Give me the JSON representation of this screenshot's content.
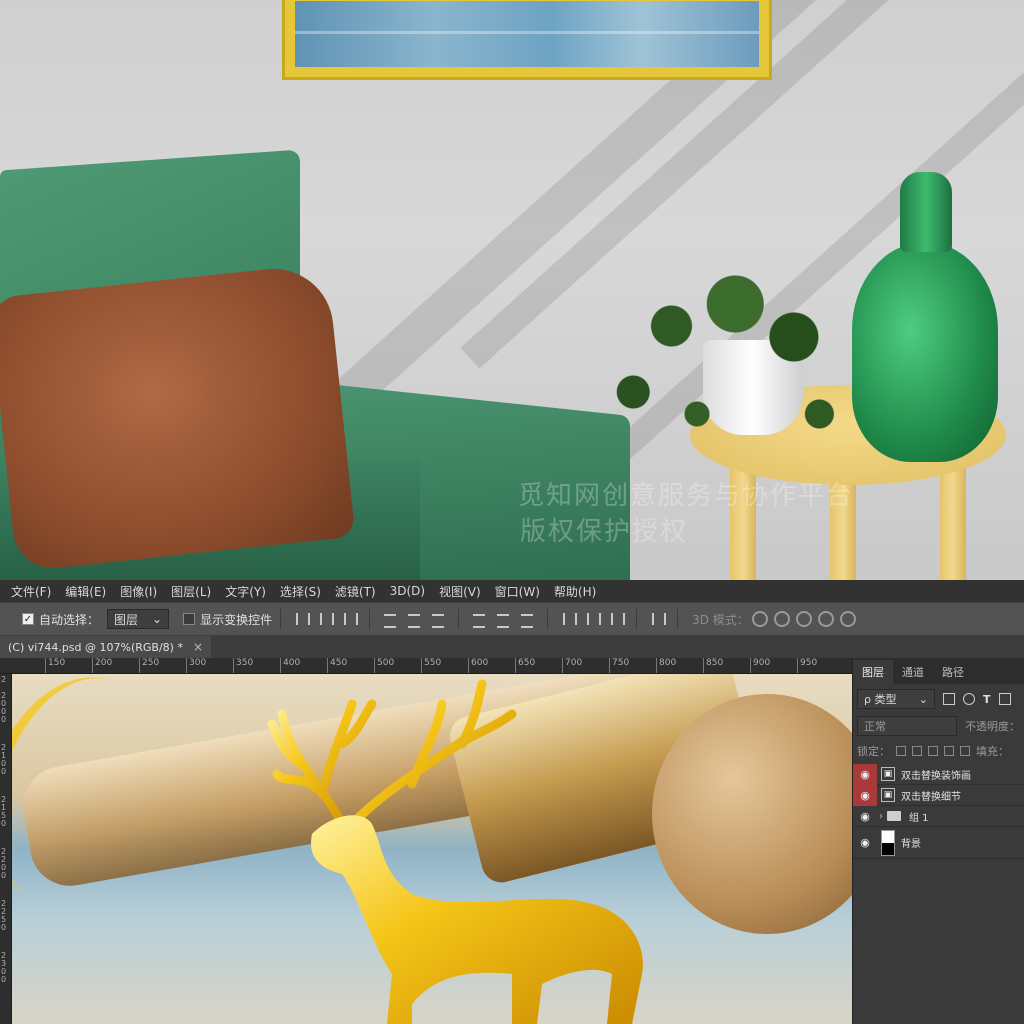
{
  "watermark": {
    "line1": "觅知网创意服务与协作平台",
    "line2": "版权保护授权"
  },
  "menu": [
    "文件(F)",
    "编辑(E)",
    "图像(I)",
    "图层(L)",
    "文字(Y)",
    "选择(S)",
    "滤镜(T)",
    "3D(D)",
    "视图(V)",
    "窗口(W)",
    "帮助(H)"
  ],
  "options": {
    "auto_select_label": "自动选择：",
    "auto_select_value": "图层",
    "show_transform_label": "显示变换控件",
    "mode_3d_label": "3D 模式："
  },
  "document": {
    "tab_title": "(C) vi744.psd @ 107%(RGB/8) *",
    "close": "×"
  },
  "ruler": {
    "top_ticks": [
      "150",
      "200",
      "250",
      "300",
      "350",
      "400",
      "450",
      "500",
      "550",
      "600",
      "650",
      "700",
      "750",
      "800",
      "850",
      "900",
      "950"
    ],
    "left_ticks": [
      "2",
      "2000",
      "2100",
      "2150",
      "2200",
      "2250",
      "2300"
    ]
  },
  "layers_panel": {
    "tabs": [
      "图层",
      "通道",
      "路径"
    ],
    "active_tab": "图层",
    "filter_label": "ρ 类型",
    "blend_mode": "正常",
    "opacity_label": "不透明度：",
    "lock_label": "锁定：",
    "fill_label": "填充：",
    "layers": [
      {
        "name": "双击替换装饰画",
        "type": "smart",
        "visible": true,
        "highlight": true
      },
      {
        "name": "双击替换细节",
        "type": "smart",
        "visible": true,
        "highlight": true
      },
      {
        "name": "组 1",
        "type": "group",
        "visible": true,
        "highlight": false
      },
      {
        "name": "背景",
        "type": "background",
        "visible": true,
        "highlight": false
      }
    ]
  },
  "colors": {
    "ps_panel": "#3a3a3a",
    "ps_menubar": "#323232",
    "eye_highlight": "#a83a3a"
  }
}
